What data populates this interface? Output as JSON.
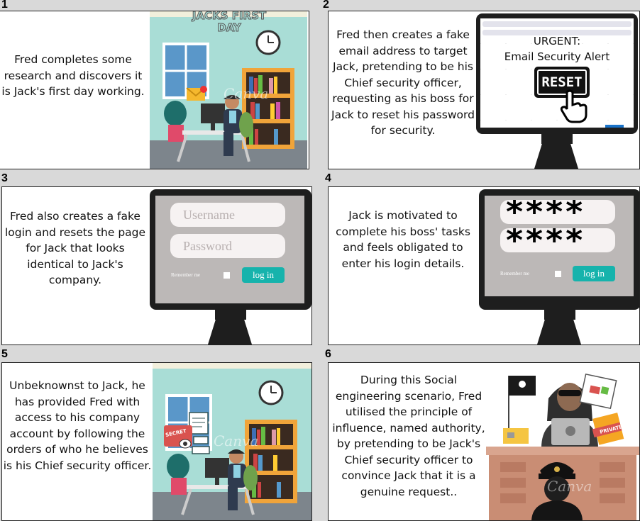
{
  "panels": [
    {
      "number": "1",
      "text": "Fred completes some research and discovers it is Jack's first day working.",
      "sign": "JACKS FIRST DAY",
      "watermark": "Canva"
    },
    {
      "number": "2",
      "text": "Fred then creates a fake email address to target Jack, pretending to be his Chief security officer, requesting as his boss for Jack to reset his password for security.",
      "email_title": "URGENT:",
      "email_subtitle": "Email Security Alert",
      "reset_button": "RESET"
    },
    {
      "number": "3",
      "text": "Fred also creates a fake login and resets the page for Jack that looks identical to Jack's company.",
      "username_placeholder": "Username",
      "password_placeholder": "Password",
      "remember_label": "Remember me",
      "login_button": "log in"
    },
    {
      "number": "4",
      "text": "Jack is motivated to complete his boss' tasks and feels obligated to enter his login details.",
      "masked_username": "****",
      "masked_password": "****",
      "remember_label": "Remember me",
      "login_button": "log in"
    },
    {
      "number": "5",
      "text": "Unbeknownst to Jack, he has provided Fred with access to his company account by following the orders of who he believes is his Chief security officer.",
      "secret_label": "SECRET",
      "watermark": "Canva"
    },
    {
      "number": "6",
      "text": "During this Social engineering scenario, Fred utilised the principle of influence, named authority, by pretending to be Jack's Chief security officer to convince Jack that it is a genuine request..",
      "private_label": "PRIVATE",
      "watermark": "Canva"
    }
  ],
  "colors": {
    "room_wall": "#a9ddd6",
    "floor": "#7d858c",
    "shelf": "#f0a43a",
    "login_teal": "#16b3ac",
    "monitor": "#1e1e1e",
    "desk": "#c98d74"
  }
}
